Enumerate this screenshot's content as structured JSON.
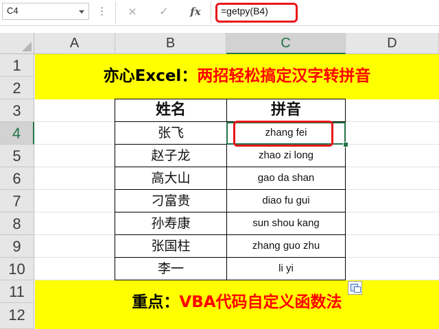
{
  "formula_bar": {
    "name_box": "C4",
    "cancel_icon": "×",
    "enter_icon": "✓",
    "fx_label": "fx",
    "formula": "=getpy(B4)"
  },
  "columns": [
    "A",
    "B",
    "C",
    "D"
  ],
  "rows": [
    "1",
    "2",
    "3",
    "4",
    "5",
    "6",
    "7",
    "8",
    "9",
    "10",
    "11",
    "12"
  ],
  "title_banner": {
    "black": "亦心Excel：",
    "red": "两招轻松搞定汉字转拼音"
  },
  "table": {
    "header_name": "姓名",
    "header_pinyin": "拼音",
    "rows": [
      {
        "name": "张飞",
        "pinyin": "zhang fei"
      },
      {
        "name": "赵子龙",
        "pinyin": "zhao zi long"
      },
      {
        "name": "高大山",
        "pinyin": "gao da shan"
      },
      {
        "name": "刁富贵",
        "pinyin": "diao fu gui"
      },
      {
        "name": "孙寿康",
        "pinyin": "sun shou kang"
      },
      {
        "name": "张国柱",
        "pinyin": "zhang guo zhu"
      },
      {
        "name": "李一",
        "pinyin": "li yi"
      }
    ]
  },
  "bottom_banner": {
    "black": "重点：",
    "red": "VBA代码自定义函数法"
  },
  "colors": {
    "banner_bg": "#ffff00",
    "accent_red": "#ff0000",
    "highlight_box": "#e8151b",
    "excel_green": "#217346"
  },
  "icons": {
    "cancel": "close-icon",
    "enter": "check-icon",
    "function": "fx-icon",
    "paste_options": "paste-options-icon"
  }
}
